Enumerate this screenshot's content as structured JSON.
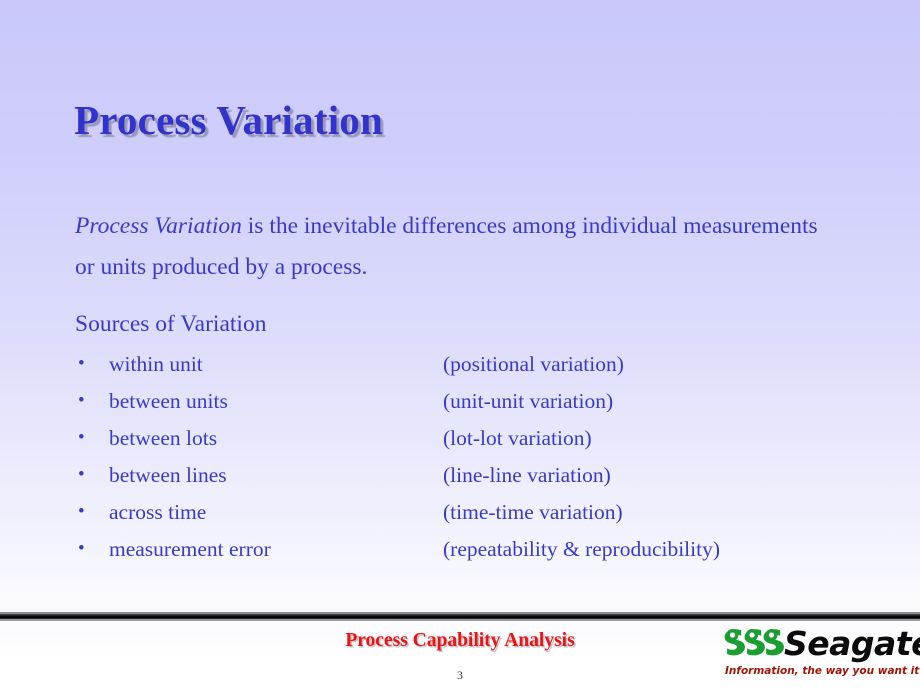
{
  "slide": {
    "title": "Process Variation",
    "paragraph": {
      "emphasis": "Process Variation",
      "rest": " is the inevitable differences among individual measurements or units produced by a process."
    },
    "sources_heading": "Sources of Variation",
    "bullet_marker": "•",
    "bullets": [
      {
        "label": "within unit",
        "note": "(positional variation)"
      },
      {
        "label": "between units",
        "note": "(unit-unit variation)"
      },
      {
        "label": "between lots",
        "note": "(lot-lot variation)"
      },
      {
        "label": "between lines",
        "note": "(line-line variation)"
      },
      {
        "label": "across time",
        "note": "(time-time variation)"
      },
      {
        "label": "measurement error",
        "note": "(repeatability & reproducibility)"
      }
    ]
  },
  "footer": {
    "title": "Process Capability Analysis",
    "page_number": "3",
    "logo": {
      "wordmark": "Seagate",
      "tagline": "Information, the way you want it"
    }
  },
  "colors": {
    "background_top": "#c9c8fb",
    "background_bottom": "#ffffff",
    "title_text": "#3232cd",
    "body_text": "#3a3ac9",
    "footer_title": "#ee1111",
    "logo_green": "#1a9e30",
    "logo_tagline": "#a01505"
  }
}
